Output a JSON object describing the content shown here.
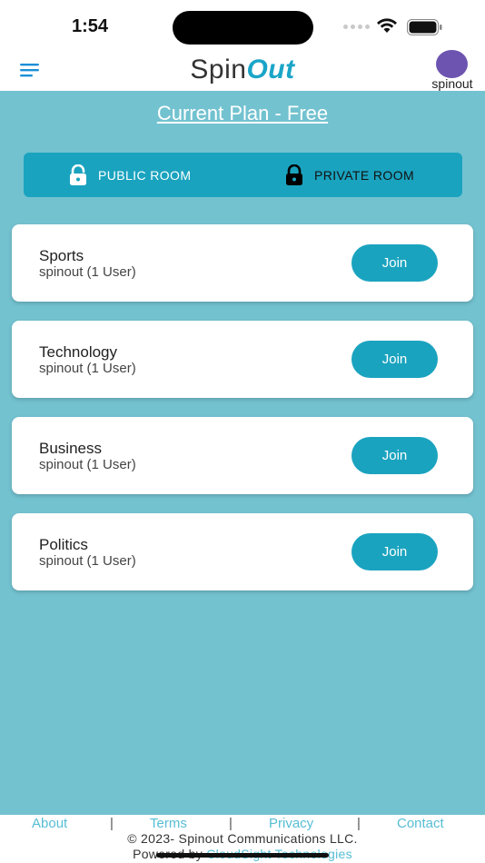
{
  "status_bar": {
    "time": "1:54"
  },
  "header": {
    "brand_spin": "Spin",
    "brand_out": "Out",
    "username": "spinout",
    "avatar_color": "#6d54b0",
    "menu_icon": "hamburger-menu-icon"
  },
  "plan": {
    "label": "Current Plan - Free"
  },
  "room_toggle": {
    "public_label": "PUBLIC ROOM",
    "private_label": "PRIVATE ROOM",
    "public_icon": "unlocked-padlock-icon",
    "private_icon": "locked-padlock-icon"
  },
  "rooms": [
    {
      "name": "Sports",
      "users": "spinout (1 User)",
      "action": "Join"
    },
    {
      "name": "Technology",
      "users": "spinout (1 User)",
      "action": "Join"
    },
    {
      "name": "Business",
      "users": "spinout (1 User)",
      "action": "Join"
    },
    {
      "name": "Politics",
      "users": "spinout (1 User)",
      "action": "Join"
    }
  ],
  "footer": {
    "links": [
      "About",
      "Terms",
      "Privacy",
      "Contact"
    ],
    "separator": "|",
    "copyright": "© 2023- Spinout Communications LLC.",
    "powered_prefix": "Powered by ",
    "powered_company": "CloudSight Technologies"
  },
  "colors": {
    "accent": "#1aa3bf",
    "background": "#73c2d0",
    "link": "#56bdd4"
  }
}
